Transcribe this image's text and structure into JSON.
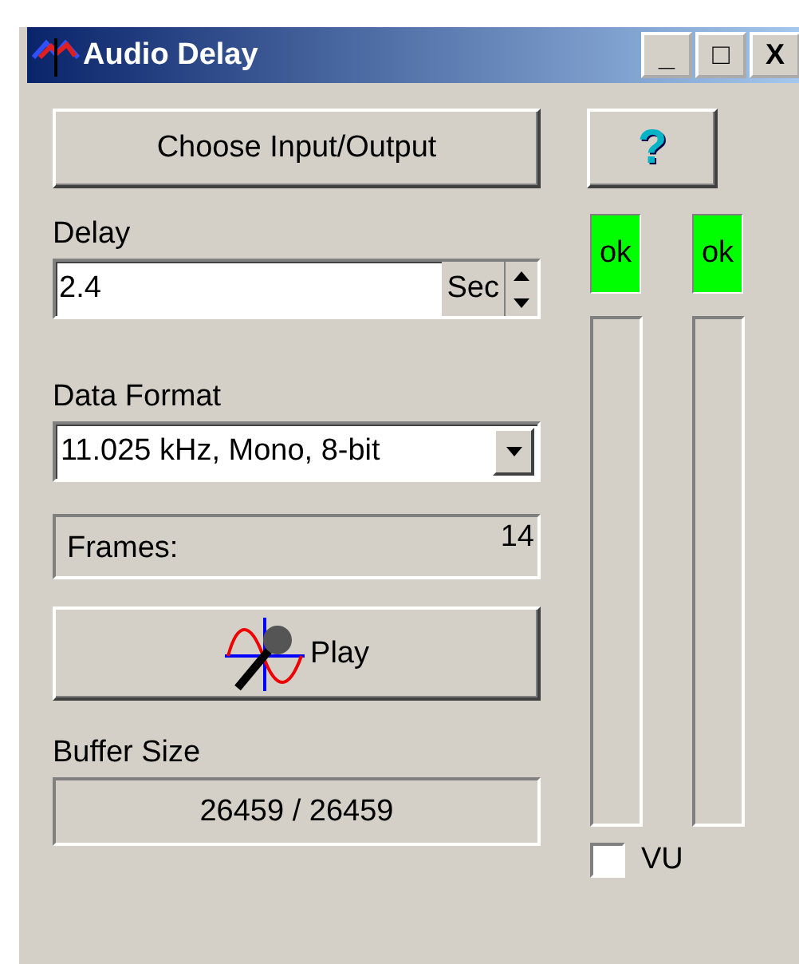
{
  "window": {
    "title": "Audio Delay",
    "controls": [
      "_",
      "□",
      "X"
    ]
  },
  "choose_button": {
    "label": "Choose Input/Output"
  },
  "help_button": {
    "label": "?"
  },
  "delay": {
    "label": "Delay",
    "value": "2.4",
    "unit": "Sec"
  },
  "data_format": {
    "label": "Data Format",
    "value": "11.025 kHz, Mono, 8-bit"
  },
  "frames": {
    "label": "Frames:",
    "value": "14"
  },
  "play_button": {
    "label": "Play"
  },
  "buffer_size": {
    "label": "Buffer Size",
    "value": "26459 / 26459"
  },
  "meters": [
    {
      "status": "ok",
      "color": "#00ff00",
      "level": 0
    },
    {
      "status": "ok",
      "color": "#00ff00",
      "level": 0
    }
  ],
  "vu": {
    "label": "VU",
    "checked": false
  }
}
